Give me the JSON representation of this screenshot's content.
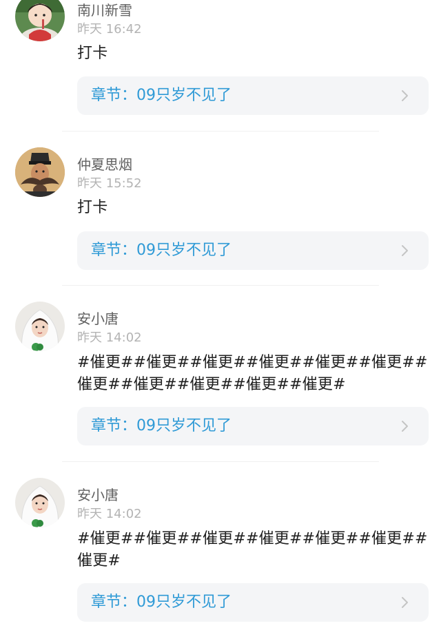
{
  "comments": [
    {
      "username": "南川新雪",
      "timestamp": "昨天 16:42",
      "content": "打卡",
      "chapter": "章节：09只岁不见了"
    },
    {
      "username": "仲夏思烟",
      "timestamp": "昨天 15:52",
      "content": "打卡",
      "chapter": "章节：09只岁不见了"
    },
    {
      "username": "安小唐",
      "timestamp": "昨天 14:02",
      "content": "#催更##催更##催更##催更##催更##催更##催更##催更##催更##催更##催更#",
      "chapter": "章节：09只岁不见了"
    },
    {
      "username": "安小唐",
      "timestamp": "昨天 14:02",
      "content": "#催更##催更##催更##催更##催更##催更##催更#",
      "chapter": "章节：09只岁不见了"
    }
  ],
  "colors": {
    "chapter_text": "#2f9ad6",
    "card_background": "#f4f5f7",
    "username": "#5f5f5f",
    "timestamp": "#b3b3b3"
  },
  "icons": {
    "chevron": "chevron-right-icon"
  }
}
